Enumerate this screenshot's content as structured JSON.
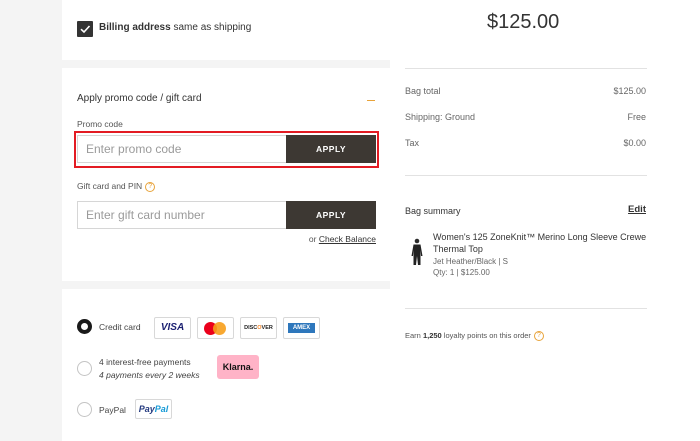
{
  "billing": {
    "checkbox_checked": true,
    "label_bold": "Billing address",
    "label_rest": " same as shipping"
  },
  "promo": {
    "title": "Apply promo code / gift card",
    "promo_label": "Promo code",
    "promo_placeholder": "Enter promo code",
    "apply_label": "APPLY",
    "gift_label": "Gift card and PIN",
    "gift_placeholder": "Enter gift card number",
    "gift_apply_label": "APPLY",
    "help_glyph": "?",
    "or_text": "or ",
    "check_balance": "Check Balance"
  },
  "payment": {
    "selected": "credit_card",
    "credit_card_label": "Credit card",
    "klarna_line1": "4 interest-free payments",
    "klarna_line2": "4 payments every 2 weeks",
    "paypal_label": "PayPal",
    "logos": {
      "visa": "VISA",
      "discover_a": "DISC",
      "discover_o": "O",
      "discover_b": "VER",
      "amex": "AMEX",
      "klarna": "Klarna.",
      "paypal_a": "Pay",
      "paypal_b": "Pal"
    }
  },
  "summary": {
    "total": "$125.00",
    "rows": [
      {
        "label": "Bag total",
        "value": "$125.00"
      },
      {
        "label": "Shipping: Ground",
        "value": "Free"
      },
      {
        "label": "Tax",
        "value": "$0.00"
      }
    ],
    "bag_summary_title": "Bag summary",
    "edit_label": "Edit",
    "product": {
      "name": "Women's 125 ZoneKnit™ Merino Long Sleeve Crewe Thermal Top",
      "variant": "Jet Heather/Black | S",
      "qty": "Qty: 1 | $125.00"
    },
    "loyalty": {
      "prefix": "Earn ",
      "points": "1,250",
      "suffix": " loyalty points on this order",
      "help_glyph": "?"
    }
  },
  "colors": {
    "accent": "#e8a33a",
    "highlight": "#e31b23",
    "button": "#3d3833"
  }
}
